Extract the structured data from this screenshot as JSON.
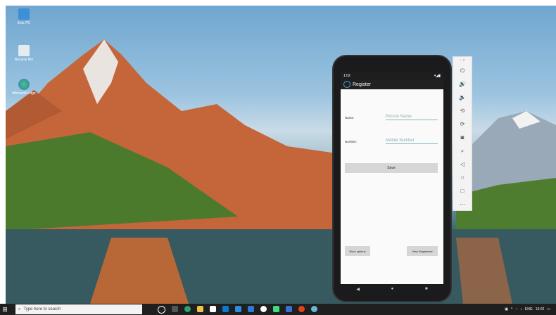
{
  "desktop": {
    "icons": [
      {
        "label": "Este PC",
        "icon": "computer-icon"
      },
      {
        "label": "Recycle Bin",
        "icon": "recycle-bin-icon"
      },
      {
        "label": "Microsoft Edge",
        "icon": "edge-icon"
      }
    ]
  },
  "emulator": {
    "status_time": "1:02",
    "app_title": "Register",
    "form": {
      "name_label": "Name:",
      "name_placeholder": "Person Name",
      "number_label": "Number:",
      "number_placeholder": "Mobile Number",
      "save_label": "Save",
      "left_button_label": "Work options",
      "view_button_label": "View Registered"
    },
    "nav": {
      "back": "◀",
      "home": "●",
      "recents": "■"
    },
    "controls": [
      "power-icon",
      "volume-up-icon",
      "volume-down-icon",
      "rotate-left-icon",
      "rotate-right-icon",
      "camera-icon",
      "zoom-icon",
      "back-icon",
      "home-icon",
      "overview-icon",
      "more-icon"
    ]
  },
  "taskbar": {
    "search_placeholder": "Type here to search",
    "tray_lang": "ENG",
    "tray_time": "13:02"
  }
}
